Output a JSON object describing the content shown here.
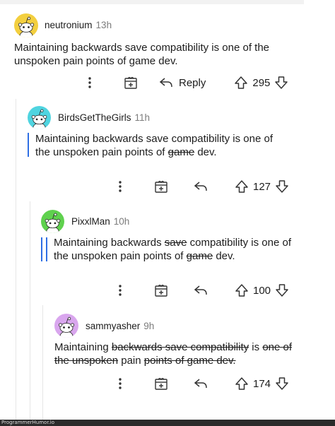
{
  "comments": [
    {
      "username": "neutronium",
      "time": "13h",
      "avatar_color": "#f3cf3f",
      "text_segments": [
        {
          "text": "Maintaining backwards save compatibility is one of the unspoken pain points of game dev.",
          "strike": false
        }
      ],
      "reply_label": "Reply",
      "votes": "295"
    },
    {
      "username": "BirdsGetTheGirls",
      "time": "11h",
      "avatar_color": "#4fd4e0",
      "quote_bars": 1,
      "text_segments": [
        {
          "text": "Maintaining backwards save compatibility is one of the unspoken pain points of ",
          "strike": false
        },
        {
          "text": "game",
          "strike": true
        },
        {
          "text": " dev.",
          "strike": false
        }
      ],
      "votes": "127"
    },
    {
      "username": "PixxlMan",
      "time": "10h",
      "avatar_color": "#5fd14e",
      "quote_bars": 2,
      "text_segments": [
        {
          "text": "Maintaining backwards ",
          "strike": false
        },
        {
          "text": "save",
          "strike": true
        },
        {
          "text": " compatibility is one of the unspoken pain points of ",
          "strike": false
        },
        {
          "text": "game",
          "strike": true
        },
        {
          "text": " dev.",
          "strike": false
        }
      ],
      "votes": "100"
    },
    {
      "username": "sammyasher",
      "time": "9h",
      "avatar_color": "#d9a6ee",
      "text_segments": [
        {
          "text": "Maintaining ",
          "strike": false
        },
        {
          "text": "backwards save compatibility",
          "strike": true
        },
        {
          "text": " is ",
          "strike": false
        },
        {
          "text": "one of the unspoken",
          "strike": true
        },
        {
          "text": " pain ",
          "strike": false
        },
        {
          "text": "points of game dev.",
          "strike": true
        }
      ],
      "votes": "174"
    }
  ],
  "icons": {
    "more": "more-vertical-icon",
    "award": "award-gift-icon",
    "reply": "reply-arrow-icon",
    "upvote": "upvote-arrow-icon",
    "downvote": "downvote-arrow-icon"
  },
  "watermark": "ProgrammerHumor.io"
}
